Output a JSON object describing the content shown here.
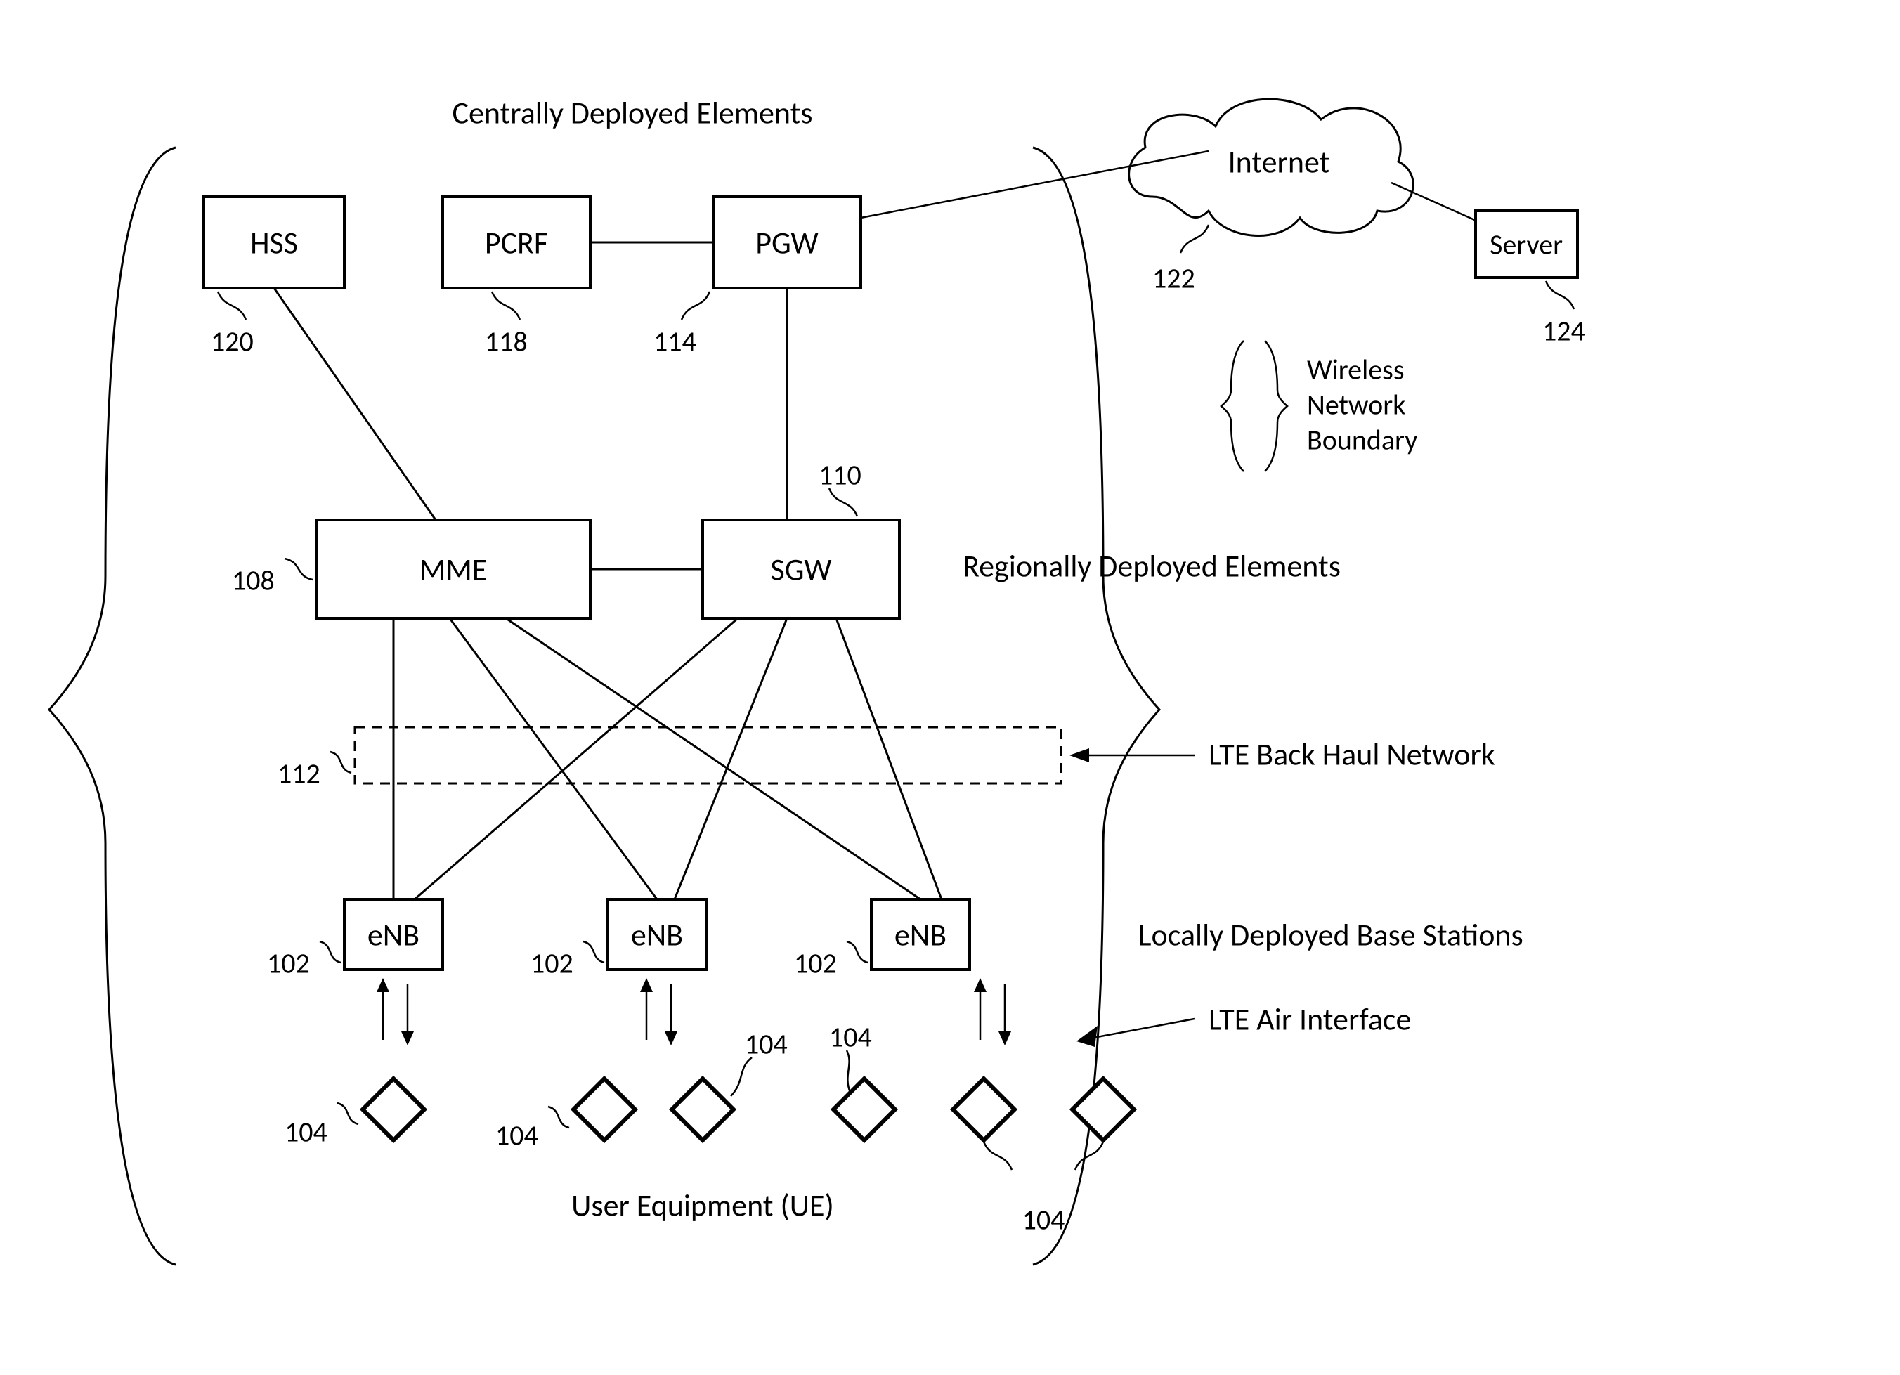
{
  "title_top": "Centrally Deployed Elements",
  "nodes": {
    "hss": "HSS",
    "pcrf": "PCRF",
    "pgw": "PGW",
    "internet": "Internet",
    "server": "Server",
    "mme": "MME",
    "sgw": "SGW",
    "enb": "eNB"
  },
  "labels": {
    "regionally": "Regionally Deployed Elements",
    "backhaul": "LTE Back Haul Network",
    "local_bs": "Locally Deployed Base Stations",
    "air": "LTE Air Interface",
    "ue": "User Equipment (UE)",
    "legend1": "Wireless",
    "legend2": "Network",
    "legend3": "Boundary"
  },
  "refs": {
    "hss": "120",
    "pcrf": "118",
    "pgw": "114",
    "internet": "122",
    "server": "124",
    "mme": "108",
    "sgw": "110",
    "backhaul": "112",
    "enb": "102",
    "ue": "104"
  }
}
